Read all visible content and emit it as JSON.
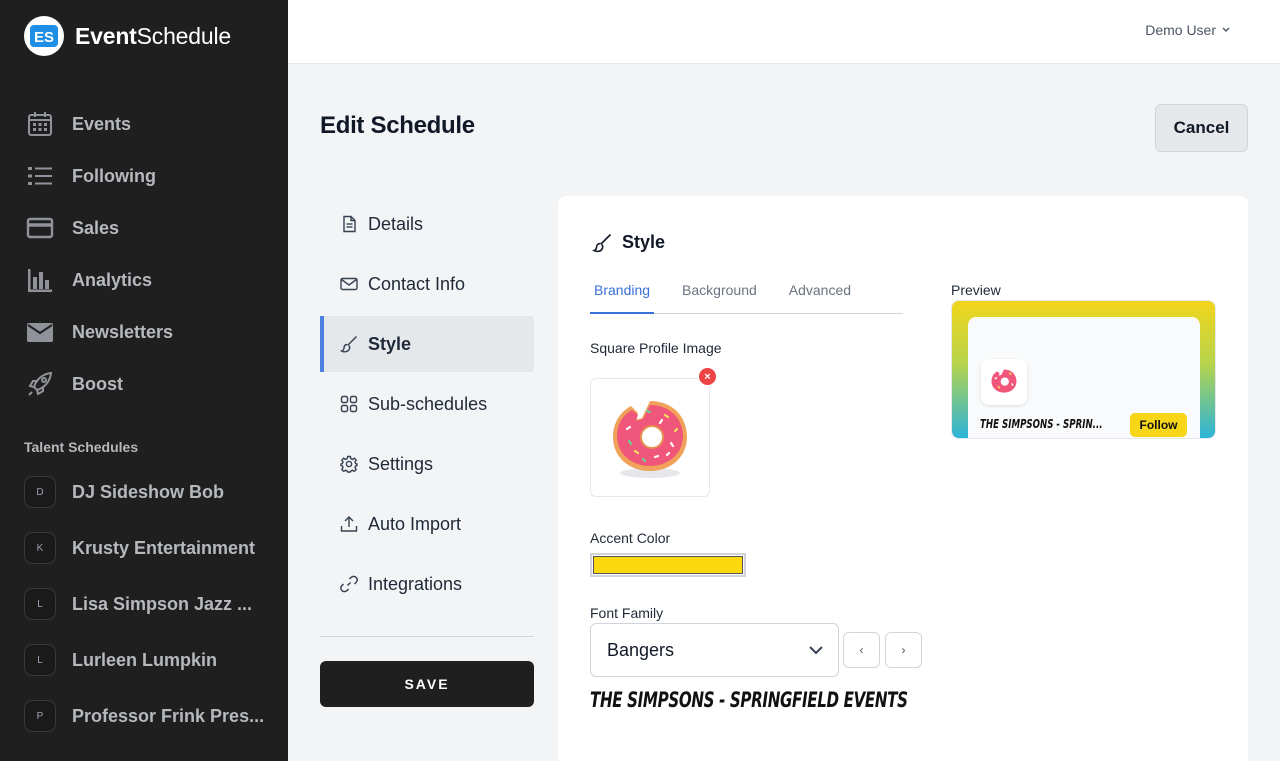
{
  "brand": {
    "name_bold": "Event",
    "name_regular": "Schedule",
    "logo_text": "ES",
    "accent": "#1f8fe6"
  },
  "user_menu": {
    "label": "Demo User"
  },
  "nav": [
    {
      "icon": "calendar-icon",
      "label": "Events"
    },
    {
      "icon": "list-icon",
      "label": "Following"
    },
    {
      "icon": "credit-card-icon",
      "label": "Sales"
    },
    {
      "icon": "bar-chart-icon",
      "label": "Analytics"
    },
    {
      "icon": "mail-icon",
      "label": "Newsletters"
    },
    {
      "icon": "rocket-icon",
      "label": "Boost"
    }
  ],
  "talent_section": {
    "title": "Talent Schedules"
  },
  "talents": [
    {
      "initial": "D",
      "name": "DJ Sideshow Bob"
    },
    {
      "initial": "K",
      "name": "Krusty Entertainment"
    },
    {
      "initial": "L",
      "name": "Lisa Simpson Jazz ..."
    },
    {
      "initial": "L",
      "name": "Lurleen Lumpkin"
    },
    {
      "initial": "P",
      "name": "Professor Frink Pres..."
    }
  ],
  "page": {
    "title": "Edit Schedule",
    "cancel_label": "Cancel",
    "save_label": "SAVE"
  },
  "subnav": [
    {
      "icon": "document-icon",
      "label": "Details"
    },
    {
      "icon": "envelope-icon",
      "label": "Contact Info"
    },
    {
      "icon": "brush-icon",
      "label": "Style"
    },
    {
      "icon": "grid-icon",
      "label": "Sub-schedules"
    },
    {
      "icon": "gear-icon",
      "label": "Settings"
    },
    {
      "icon": "upload-icon",
      "label": "Auto Import"
    },
    {
      "icon": "link-icon",
      "label": "Integrations"
    }
  ],
  "style_card": {
    "title": "Style",
    "tabs": [
      "Branding",
      "Background",
      "Advanced"
    ],
    "active_tab": "Branding",
    "profile_image_label": "Square Profile Image",
    "remove_symbol": "×",
    "accent_color_label": "Accent Color",
    "accent_color": "#fcd90f",
    "font_family_label": "Font Family",
    "font_family_value": "Bangers",
    "prev_symbol": "‹",
    "next_symbol": "›",
    "font_preview_text": "THE SIMPSONS - SPRINGFIELD EVENTS",
    "preview_label": "Preview",
    "preview_name": "THE SIMPSONS - SPRIN...",
    "follow_label": "Follow"
  }
}
